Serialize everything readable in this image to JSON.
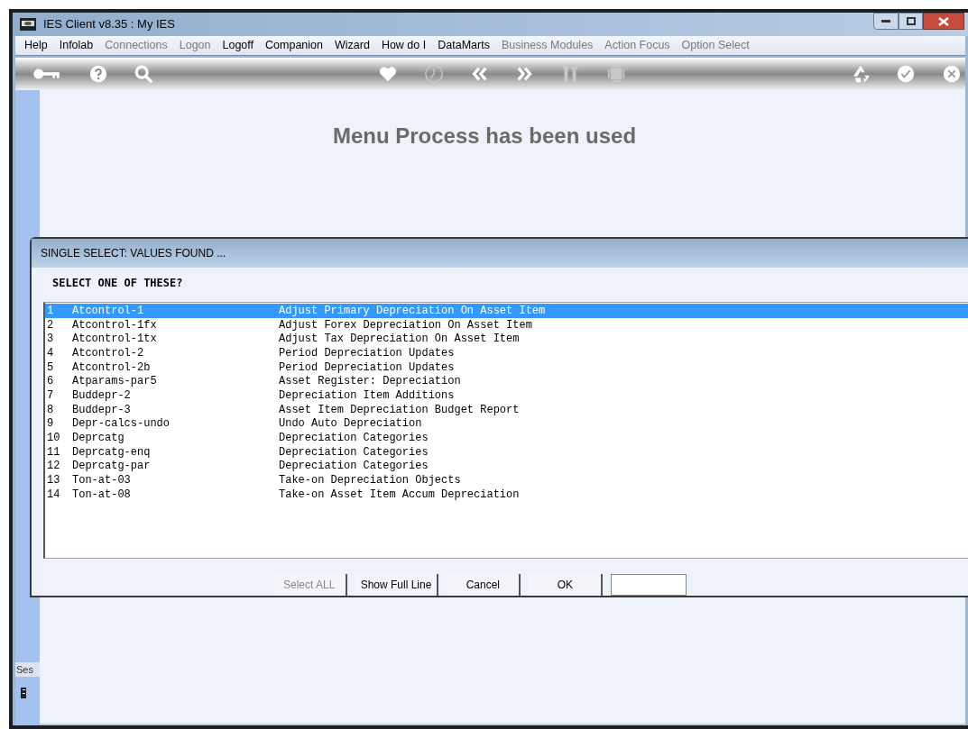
{
  "window": {
    "title": "IES Client v8.35 : My IES"
  },
  "menu": [
    {
      "label": "Help",
      "disabled": false
    },
    {
      "label": "Infolab",
      "disabled": false
    },
    {
      "label": "Connections",
      "disabled": true
    },
    {
      "label": "Logon",
      "disabled": true
    },
    {
      "label": "Logoff",
      "disabled": false
    },
    {
      "label": "Companion",
      "disabled": false
    },
    {
      "label": "Wizard",
      "disabled": false
    },
    {
      "label": "How do I",
      "disabled": false
    },
    {
      "label": "DataMarts",
      "disabled": false
    },
    {
      "label": "Business Modules",
      "disabled": true
    },
    {
      "label": "Action Focus",
      "disabled": true
    },
    {
      "label": "Option Select",
      "disabled": true
    }
  ],
  "toolbar": [
    {
      "kind": "key",
      "disabled": false
    },
    {
      "kind": "help",
      "disabled": false
    },
    {
      "kind": "search",
      "disabled": false
    },
    {
      "kind": "gap"
    },
    {
      "kind": "heart",
      "disabled": false
    },
    {
      "kind": "clock",
      "disabled": true
    },
    {
      "kind": "back",
      "disabled": false
    },
    {
      "kind": "forward",
      "disabled": false
    },
    {
      "kind": "tools",
      "disabled": true
    },
    {
      "kind": "chip",
      "disabled": true
    },
    {
      "kind": "gap"
    },
    {
      "kind": "recycle",
      "disabled": false
    },
    {
      "kind": "check",
      "disabled": false
    },
    {
      "kind": "close",
      "disabled": false
    }
  ],
  "heading": "Menu Process has been used",
  "session_label": "Ses",
  "dialog": {
    "title": "SINGLE SELECT: VALUES FOUND  ...",
    "prompt": "SELECT ONE OF THESE?",
    "rows": [
      {
        "number": "1",
        "code": "Atcontrol-1",
        "description": "Adjust Primary Depreciation On Asset Item",
        "selected": true
      },
      {
        "number": "2",
        "code": "Atcontrol-1fx",
        "description": "Adjust Forex Depreciation On Asset Item",
        "selected": false
      },
      {
        "number": "3",
        "code": "Atcontrol-1tx",
        "description": "Adjust Tax Depreciation On Asset Item",
        "selected": false
      },
      {
        "number": "4",
        "code": "Atcontrol-2",
        "description": "Period Depreciation Updates",
        "selected": false
      },
      {
        "number": "5",
        "code": "Atcontrol-2b",
        "description": "Period Depreciation Updates",
        "selected": false
      },
      {
        "number": "6",
        "code": "Atparams-par5",
        "description": "Asset Register: Depreciation",
        "selected": false
      },
      {
        "number": "7",
        "code": "Buddepr-2",
        "description": "Depreciation Item Additions",
        "selected": false
      },
      {
        "number": "8",
        "code": "Buddepr-3",
        "description": "Asset Item Depreciation Budget Report",
        "selected": false
      },
      {
        "number": "9",
        "code": "Depr-calcs-undo",
        "description": "Undo Auto Depreciation",
        "selected": false
      },
      {
        "number": "10",
        "code": "Deprcatg",
        "description": "Depreciation Categories",
        "selected": false
      },
      {
        "number": "11",
        "code": "Deprcatg-enq",
        "description": "Depreciation Categories",
        "selected": false
      },
      {
        "number": "12",
        "code": "Deprcatg-par",
        "description": "Depreciation Categories",
        "selected": false
      },
      {
        "number": "13",
        "code": "Ton-at-03",
        "description": "Take-on Depreciation Objects",
        "selected": false
      },
      {
        "number": "14",
        "code": "Ton-at-08",
        "description": "Take-on Asset Item Accum Depreciation",
        "selected": false
      }
    ],
    "buttons": [
      {
        "label": "Select ALL",
        "disabled": true
      },
      {
        "label": "Show Full Line",
        "disabled": false
      },
      {
        "label": "Cancel",
        "disabled": false
      },
      {
        "label": "OK",
        "disabled": false
      }
    ]
  }
}
